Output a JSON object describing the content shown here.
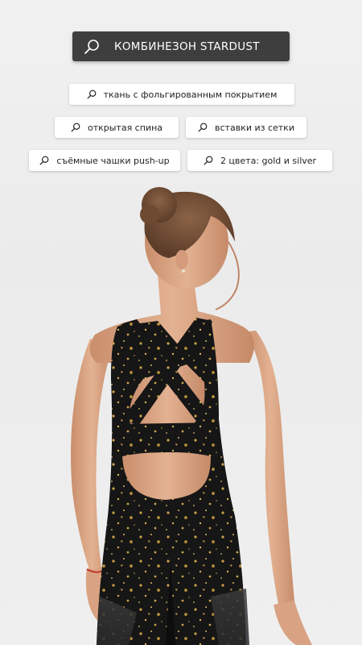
{
  "header": {
    "title": "КОМБИНЕЗОН STARDUST",
    "icon": "search-icon"
  },
  "features": [
    {
      "label": "ткань с фольгированным покрытием",
      "icon": "search-icon"
    },
    {
      "label": "открытая спина",
      "icon": "search-icon"
    },
    {
      "label": "вставки из сетки",
      "icon": "search-icon"
    },
    {
      "label": "съёмные чашки push-up",
      "icon": "search-icon"
    },
    {
      "label": "2 цвета: gold и silver",
      "icon": "search-icon"
    }
  ],
  "photo": {
    "subject": "woman-back-view-black-gold-jumpsuit"
  },
  "colors": {
    "title_bg": "#3e3e3e",
    "chip_bg": "#ffffff",
    "fabric": "#151515",
    "foil": "#c9a24a"
  }
}
